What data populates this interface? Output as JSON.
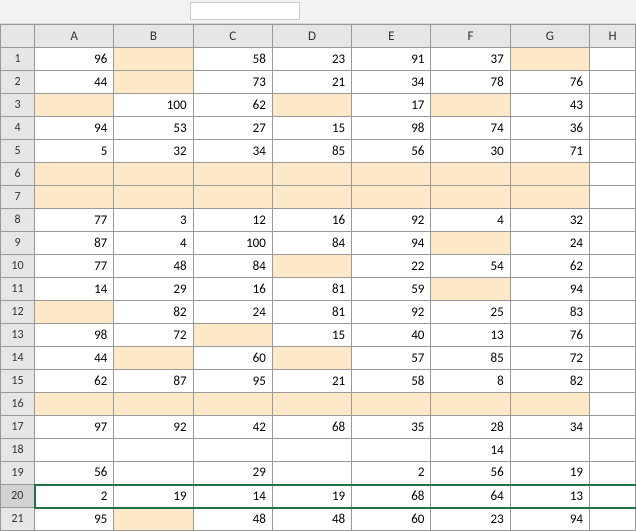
{
  "columns": [
    "A",
    "B",
    "C",
    "D",
    "E",
    "F",
    "G",
    "H"
  ],
  "row_count": 21,
  "selected_row": 20,
  "chart_data": {
    "type": "table",
    "rows": [
      {
        "A": 96,
        "B": null,
        "C": 58,
        "D": 23,
        "E": 91,
        "F": 37,
        "G": null
      },
      {
        "A": 44,
        "B": null,
        "C": 73,
        "D": 21,
        "E": 34,
        "F": 78,
        "G": 76
      },
      {
        "A": null,
        "B": 100,
        "C": 62,
        "D": null,
        "E": 17,
        "F": null,
        "G": 43
      },
      {
        "A": 94,
        "B": 53,
        "C": 27,
        "D": 15,
        "E": 98,
        "F": 74,
        "G": 36
      },
      {
        "A": 5,
        "B": 32,
        "C": 34,
        "D": 85,
        "E": 56,
        "F": 30,
        "G": 71
      },
      {
        "A": null,
        "B": null,
        "C": null,
        "D": null,
        "E": null,
        "F": null,
        "G": null
      },
      {
        "A": null,
        "B": null,
        "C": null,
        "D": null,
        "E": null,
        "F": null,
        "G": null
      },
      {
        "A": 77,
        "B": 3,
        "C": 12,
        "D": 16,
        "E": 92,
        "F": 4,
        "G": 32
      },
      {
        "A": 87,
        "B": 4,
        "C": 100,
        "D": 84,
        "E": 94,
        "F": null,
        "G": 24
      },
      {
        "A": 77,
        "B": 48,
        "C": 84,
        "D": null,
        "E": 22,
        "F": 54,
        "G": 62
      },
      {
        "A": 14,
        "B": 29,
        "C": 16,
        "D": 81,
        "E": 59,
        "F": null,
        "G": 94
      },
      {
        "A": null,
        "B": 82,
        "C": 24,
        "D": 81,
        "E": 92,
        "F": 25,
        "G": 83
      },
      {
        "A": 98,
        "B": 72,
        "C": null,
        "D": 15,
        "E": 40,
        "F": 13,
        "G": 76
      },
      {
        "A": 44,
        "B": null,
        "C": 60,
        "D": null,
        "E": 57,
        "F": 85,
        "G": 72
      },
      {
        "A": 62,
        "B": 87,
        "C": 95,
        "D": 21,
        "E": 58,
        "F": 8,
        "G": 82
      },
      {
        "A": null,
        "B": null,
        "C": null,
        "D": null,
        "E": null,
        "F": null,
        "G": null
      },
      {
        "A": 97,
        "B": 92,
        "C": 42,
        "D": 68,
        "E": 35,
        "F": 28,
        "G": 34
      },
      {
        "A": null,
        "B": null,
        "C": null,
        "D": null,
        "E": null,
        "F": 14,
        "G": null
      },
      {
        "A": 56,
        "B": null,
        "C": 29,
        "D": null,
        "E": 2,
        "F": 56,
        "G": 19
      },
      {
        "A": 2,
        "B": 19,
        "C": 14,
        "D": 19,
        "E": 68,
        "F": 64,
        "G": 13
      },
      {
        "A": 95,
        "B": null,
        "C": 48,
        "D": 48,
        "E": 60,
        "F": 23,
        "G": 94
      }
    ],
    "highlight_empty": true,
    "highlight_rows_all": [
      6,
      7,
      16
    ],
    "plain_empty": {
      "18": [
        "A",
        "B",
        "C",
        "D",
        "E",
        "G"
      ],
      "19": [
        "B",
        "D"
      ]
    }
  }
}
